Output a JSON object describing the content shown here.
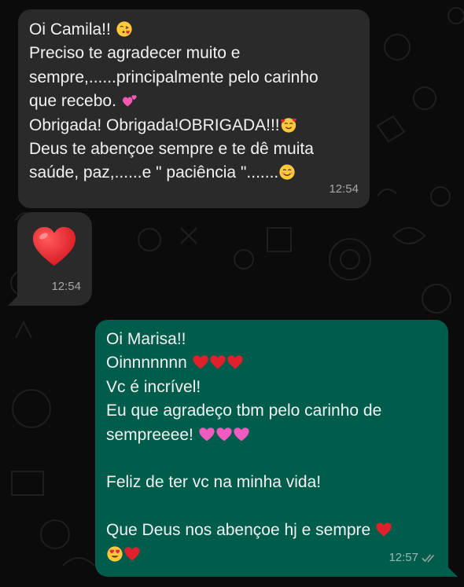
{
  "messages": [
    {
      "direction": "incoming",
      "lines": [
        "Oi Camila!!",
        "Preciso te agradecer muito e",
        "sempre,......principalmente pelo carinho",
        "que recebo.",
        "Obrigada! Obrigada!OBRIGADA!!!",
        "Deus te abençoe sempre e te dê muita",
        "saúde, paz,......e \" paciência \"......."
      ],
      "time": "12:54"
    },
    {
      "direction": "incoming",
      "emoji": "red-heart-icon",
      "time": "12:54"
    },
    {
      "direction": "outgoing",
      "lines": [
        "Oi Marisa!!",
        "Oinnnnnnn",
        "Vc é incrível!",
        "Eu que agradeço tbm pelo carinho de",
        "sempreeee!",
        "",
        "Feliz de ter vc na minha vida!",
        "",
        "Que Deus nos abençoe hj e sempre"
      ],
      "time": "12:57",
      "status": "read"
    }
  ],
  "emoji_icons": {
    "kiss": "face-blowing-kiss-icon",
    "two_hearts": "two-hearts-icon",
    "smiling_hearts": "smiling-face-with-hearts-icon",
    "smile": "smiling-face-icon",
    "red_heart": "red-heart-icon",
    "pink_heart": "pink-heart-icon",
    "heart_eyes": "heart-eyes-icon"
  },
  "colors": {
    "background": "#0b0b0b",
    "incoming_bubble": "#2a2a2a",
    "outgoing_bubble": "#005c4b",
    "text": "#f2f2f2",
    "timestamp": "#9a9a9a"
  }
}
